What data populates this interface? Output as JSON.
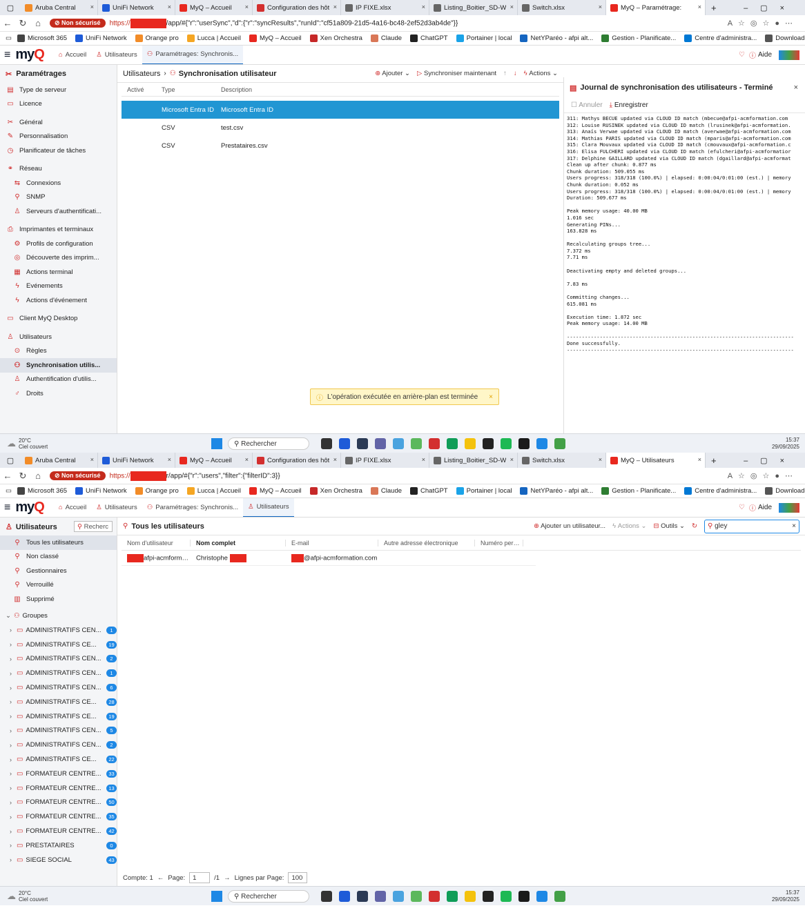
{
  "screen1": {
    "tabs": [
      {
        "label": "Aruba Central",
        "color": "#f28c28"
      },
      {
        "label": "UniFi Network",
        "color": "#1e5bd8"
      },
      {
        "label": "MyQ – Accueil",
        "color": "#e8281f"
      },
      {
        "label": "Configuration des hôt",
        "color": "#d32f2f"
      },
      {
        "label": "IP FIXE.xlsx",
        "color": "#666666"
      },
      {
        "label": "Listing_Boitier_SD-W",
        "color": "#666666"
      },
      {
        "label": "Switch.xlsx",
        "color": "#666666"
      },
      {
        "label": "MyQ – Paramétrage:",
        "color": "#e8281f"
      }
    ],
    "url_prefix": "https://",
    "url_rest": "/app/#{\"r\":\"userSync\",\"d\":{\"r\":\"syncResults\",\"runId\":\"cf51a809-21d5-4a16-bc48-2ef52d3ab4de\"}}",
    "app_tabs": [
      "Accueil",
      "Utilisateurs",
      "Paramétrages: Synchronis..."
    ],
    "sidebar_title": "Paramétrages",
    "sidebar_items": [
      {
        "label": "Type de serveur",
        "icon": "▤",
        "sub": false
      },
      {
        "label": "Licence",
        "icon": "▭",
        "sub": false
      },
      {
        "sep": true
      },
      {
        "label": "Général",
        "icon": "✂",
        "sub": false
      },
      {
        "label": "Personnalisation",
        "icon": "✎",
        "sub": false
      },
      {
        "label": "Planificateur de tâches",
        "icon": "◷",
        "sub": false
      },
      {
        "sep": true
      },
      {
        "label": "Réseau",
        "icon": "⚭",
        "sub": false
      },
      {
        "label": "Connexions",
        "icon": "⇆",
        "sub": true
      },
      {
        "label": "SNMP",
        "icon": "⚲",
        "sub": true
      },
      {
        "label": "Serveurs d'authentificati...",
        "icon": "♙",
        "sub": true
      },
      {
        "sep": true
      },
      {
        "label": "Imprimantes et terminaux",
        "icon": "⎙",
        "sub": false
      },
      {
        "label": "Profils de configuration",
        "icon": "⚙",
        "sub": true
      },
      {
        "label": "Découverte des imprim...",
        "icon": "◎",
        "sub": true
      },
      {
        "label": "Actions terminal",
        "icon": "▦",
        "sub": true
      },
      {
        "label": "Evénements",
        "icon": "ϟ",
        "sub": true
      },
      {
        "label": "Actions d'événement",
        "icon": "ϟ",
        "sub": true
      },
      {
        "sep": true
      },
      {
        "label": "Client MyQ Desktop",
        "icon": "▭",
        "sub": false
      },
      {
        "sep": true
      },
      {
        "label": "Utilisateurs",
        "icon": "♙",
        "sub": false
      },
      {
        "label": "Règles",
        "icon": "⊙",
        "sub": true
      },
      {
        "label": "Synchronisation utilis...",
        "icon": "⚇",
        "sub": true,
        "selected": true
      },
      {
        "label": "Authentification d'utilis...",
        "icon": "♙",
        "sub": true
      },
      {
        "label": "Droits",
        "icon": "♂",
        "sub": true
      }
    ],
    "breadcrumb": "Utilisateurs",
    "page_title": "Synchronisation utilisateur",
    "toolbar": {
      "add": "Ajouter",
      "sync": "Synchroniser maintenant",
      "actions": "Actions"
    },
    "columns": [
      "Activé",
      "Type",
      "Description"
    ],
    "rows": [
      {
        "type": "Microsoft Entra ID",
        "description": "Microsoft Entra ID",
        "enabled": true
      },
      {
        "type": "CSV",
        "description": "test.csv",
        "enabled": false
      },
      {
        "type": "CSV",
        "description": "Prestataires.csv",
        "enabled": false
      }
    ],
    "log_title": "Journal de synchronisation des utilisateurs - Terminé",
    "log_cancel": "Annuler",
    "log_save": "Enregistrer",
    "log_lines": "311: Mathys BECUE updated via CLOUD ID match (mbecue@afpi-acmformation.com\n312: Louise RUSINEK updated via CLOUD ID match (lrusinek@afpi-acmformation.\n313: Anaïs Verwae updated via CLOUD ID match (averwae@afpi-acmformation.com\n314: Mathias PARIS updated via CLOUD ID match (mparis@afpi-acmformation.com\n315: Clara Mouvaux updated via CLOUD ID match (cmouvaux@afpi-acmformation.c\n316: Elisa FULCHERI updated via CLOUD ID match (efulcheri@afpi-acmformatior\n317: Delphine GAILLARD updated via CLOUD ID match (dgaillard@afpi-acmformat\nClean up after chunk: 0.877 ms\nChunk duration: 509.055 ms\nUsers progress: 318/318 (100.0%) | elapsed: 0:00:04/0:01:00 (est.) | memory\nChunk duration: 0.052 ms\nUsers progress: 318/318 (100.0%) | elapsed: 0:00:04/0:01:00 (est.) | memory\nDuration: 509.677 ms\n\nPeak memory usage: 40.00 MB\n1.016 sec\nGenerating PINs...\n163.828 ms\n\nRecalculating groups tree...\n7.372 ms\n7.71 ms\n\nDeactivating empty and deleted groups...\n\n7.83 ms\n\nCommitting changes...\n615.081 ms\n\nExecution time: 1.872 sec\nPeak memory usage: 14.00 MB\n\n----------------------------------------------------------------------------\nDone successfully.\n----------------------------------------------------------------------------",
    "toast": "L'opération exécutée en arrière-plan est terminée",
    "taskbar": {
      "temp": "20°C",
      "weather": "Ciel couvert",
      "search": "Rechercher",
      "time": "15:37",
      "date": "29/09/2025"
    }
  },
  "screen2": {
    "tabs": [
      {
        "label": "Aruba Central",
        "color": "#f28c28"
      },
      {
        "label": "UniFi Network",
        "color": "#1e5bd8"
      },
      {
        "label": "MyQ – Accueil",
        "color": "#e8281f"
      },
      {
        "label": "Configuration des hôt",
        "color": "#d32f2f"
      },
      {
        "label": "IP FIXE.xlsx",
        "color": "#666666"
      },
      {
        "label": "Listing_Boitier_SD-W",
        "color": "#666666"
      },
      {
        "label": "Switch.xlsx",
        "color": "#666666"
      },
      {
        "label": "MyQ – Utilisateurs",
        "color": "#e8281f"
      }
    ],
    "url_prefix": "https://",
    "url_rest": "r/app/#{\"r\":\"users\",\"filter\":{\"filterID\":3}}",
    "app_tabs": [
      "Accueil",
      "Utilisateurs",
      "Paramétrages: Synchronis...",
      "Utilisateurs"
    ],
    "sidebar_title": "Utilisateurs",
    "sidebar_search": "Recherc",
    "filters": [
      "Tous les utilisateurs",
      "Non classé",
      "Gestionnaires",
      "Verrouillé",
      "Supprimé"
    ],
    "groups_label": "Groupes",
    "groups": [
      {
        "name": "ADMINISTRATIFS CEN...",
        "count": "1"
      },
      {
        "name": "ADMINISTRATIFS CE...",
        "count": "19"
      },
      {
        "name": "ADMINISTRATIFS CEN...",
        "count": "2"
      },
      {
        "name": "ADMINISTRATIFS CEN...",
        "count": "1"
      },
      {
        "name": "ADMINISTRATIFS CEN...",
        "count": "6"
      },
      {
        "name": "ADMINISTRATIFS CE...",
        "count": "28"
      },
      {
        "name": "ADMINISTRATIFS CE...",
        "count": "19"
      },
      {
        "name": "ADMINISTRATIFS CEN...",
        "count": "5"
      },
      {
        "name": "ADMINISTRATIFS CEN...",
        "count": "2"
      },
      {
        "name": "ADMINISTRATIFS CE...",
        "count": "22"
      },
      {
        "name": "FORMATEUR CENTRE...",
        "count": "33"
      },
      {
        "name": "FORMATEUR CENTRE...",
        "count": "13"
      },
      {
        "name": "FORMATEUR CENTRE...",
        "count": "50"
      },
      {
        "name": "FORMATEUR CENTRE...",
        "count": "35"
      },
      {
        "name": "FORMATEUR CENTRE...",
        "count": "42"
      },
      {
        "name": "PRESTATAIRES",
        "count": "0"
      },
      {
        "name": "SIEGE SOCIAL",
        "count": "43"
      }
    ],
    "page_title": "Tous les utilisateurs",
    "toolbar": {
      "add": "Ajouter un utilisateur...",
      "actions": "Actions",
      "tools": "Outils",
      "search_value": "gley"
    },
    "columns": [
      "Nom d'utilisateur",
      "Nom complet",
      "E-mail",
      "Autre adresse électronique",
      "Numéro person..."
    ],
    "user": {
      "username": "afpi-acmforma...",
      "fullname": "Christophe",
      "email": "@afpi-acmformation.com"
    },
    "footer": {
      "count": "Compte: 1",
      "page_label": "Page:",
      "page": "1",
      "of": "/1",
      "rows_label": "Lignes par Page:",
      "rows": "100"
    },
    "taskbar": {
      "temp": "20°C",
      "weather": "Ciel couvert",
      "search": "Rechercher",
      "time": "15:37",
      "date": "29/09/2025"
    }
  },
  "common": {
    "help": "Aide",
    "bookmarks": [
      "Microsoft 365",
      "UniFi Network",
      "Orange pro",
      "Lucca | Accueil",
      "MyQ – Accueil",
      "Xen Orchestra",
      "Claude",
      "ChatGPT",
      "Portainer | local",
      "NetYParéo - afpi alt...",
      "Gestion - Planificate...",
      "Centre d'administra...",
      "Download Acer Sup..."
    ],
    "bookmark_colors": [
      "#444444",
      "#1e5bd8",
      "#f28c28",
      "#f5a623",
      "#e8281f",
      "#c62828",
      "#d97757",
      "#222222",
      "#1aa3e8",
      "#1565c0",
      "#2e7d32",
      "#0078d4",
      "#555555"
    ]
  }
}
